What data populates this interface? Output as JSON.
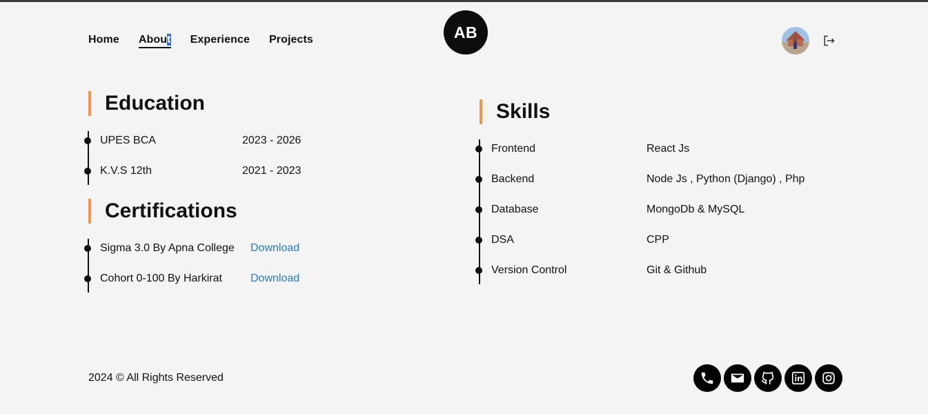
{
  "nav": {
    "items": [
      {
        "label": "Home"
      },
      {
        "label_before": "Abou",
        "label_selected": "t"
      },
      {
        "label": "Experience"
      },
      {
        "label": "Projects"
      }
    ]
  },
  "logo": {
    "text": "AB"
  },
  "header_icons": {
    "avatar": "profile-avatar",
    "logout": "logout-icon"
  },
  "education": {
    "title": "Education",
    "items": [
      {
        "name": "UPES BCA",
        "years": "2023 - 2026"
      },
      {
        "name": "K.V.S 12th",
        "years": "2021 - 2023"
      }
    ]
  },
  "certifications": {
    "title": "Certifications",
    "items": [
      {
        "name": "Sigma 3.0 By Apna College",
        "action": "Download"
      },
      {
        "name": "Cohort 0-100 By Harkirat",
        "action": "Download"
      }
    ]
  },
  "skills": {
    "title": "Skills",
    "items": [
      {
        "category": "Frontend",
        "value": "React Js"
      },
      {
        "category": "Backend",
        "value": "Node Js , Python (Django) , Php"
      },
      {
        "category": "Database",
        "value": "MongoDb & MySQL"
      },
      {
        "category": "DSA",
        "value": "CPP"
      },
      {
        "category": "Version Control",
        "value": "Git & Github"
      }
    ]
  },
  "footer": {
    "copyright": "2024 © All Rights Reserved",
    "socials": [
      "phone-icon",
      "mail-icon",
      "github-icon",
      "linkedin-icon",
      "instagram-icon"
    ]
  },
  "colors": {
    "accent": "#f0954a",
    "link": "#2a7ac4",
    "selection": "#2f6bd8"
  }
}
